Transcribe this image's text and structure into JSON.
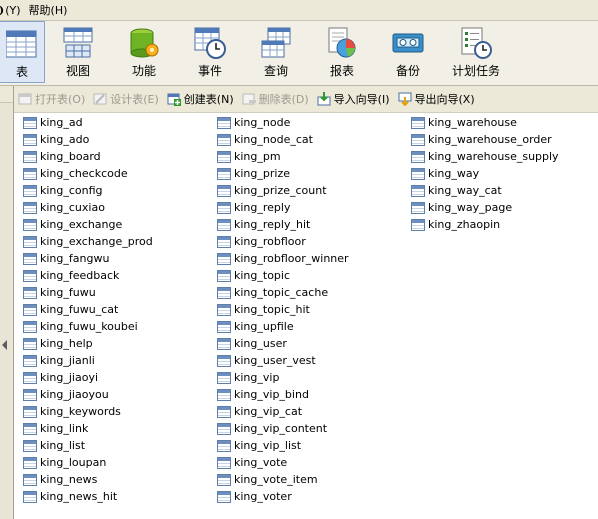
{
  "menu": {
    "items": [
      "❩(Y)",
      "帮助(H)"
    ]
  },
  "bigtoolbar": {
    "buttons": [
      {
        "label": "表",
        "active": true
      },
      {
        "label": "视图"
      },
      {
        "label": "功能"
      },
      {
        "label": "事件"
      },
      {
        "label": "查询"
      },
      {
        "label": "报表"
      },
      {
        "label": "备份"
      },
      {
        "label": "计划任务"
      }
    ]
  },
  "actions": {
    "open": "打开表(O)",
    "design": "设计表(E)",
    "create": "创建表(N)",
    "delete": "删除表(D)",
    "import": "导入向导(I)",
    "export": "导出向导(X)"
  },
  "tables": {
    "col1": [
      "king_ad",
      "king_ado",
      "king_board",
      "king_checkcode",
      "king_config",
      "king_cuxiao",
      "king_exchange",
      "king_exchange_prod",
      "king_fangwu",
      "king_feedback",
      "king_fuwu",
      "king_fuwu_cat",
      "king_fuwu_koubei",
      "king_help",
      "king_jianli",
      "king_jiaoyi",
      "king_jiaoyou",
      "king_keywords",
      "king_link",
      "king_list",
      "king_loupan",
      "king_news",
      "king_news_hit"
    ],
    "col2": [
      "king_node",
      "king_node_cat",
      "king_pm",
      "king_prize",
      "king_prize_count",
      "king_reply",
      "king_reply_hit",
      "king_robfloor",
      "king_robfloor_winner",
      "king_topic",
      "king_topic_cache",
      "king_topic_hit",
      "king_upfile",
      "king_user",
      "king_user_vest",
      "king_vip",
      "king_vip_bind",
      "king_vip_cat",
      "king_vip_content",
      "king_vip_list",
      "king_vote",
      "king_vote_item",
      "king_voter"
    ],
    "col3": [
      "king_warehouse",
      "king_warehouse_order",
      "king_warehouse_supply",
      "king_way",
      "king_way_cat",
      "king_way_page",
      "king_zhaopin"
    ]
  },
  "colors": {
    "toolbar_bg": "#f2f0e6",
    "menubar_bg": "#ece9d8",
    "disabled_text": "#9c9a8f",
    "active_btn": "#dde7f5"
  }
}
